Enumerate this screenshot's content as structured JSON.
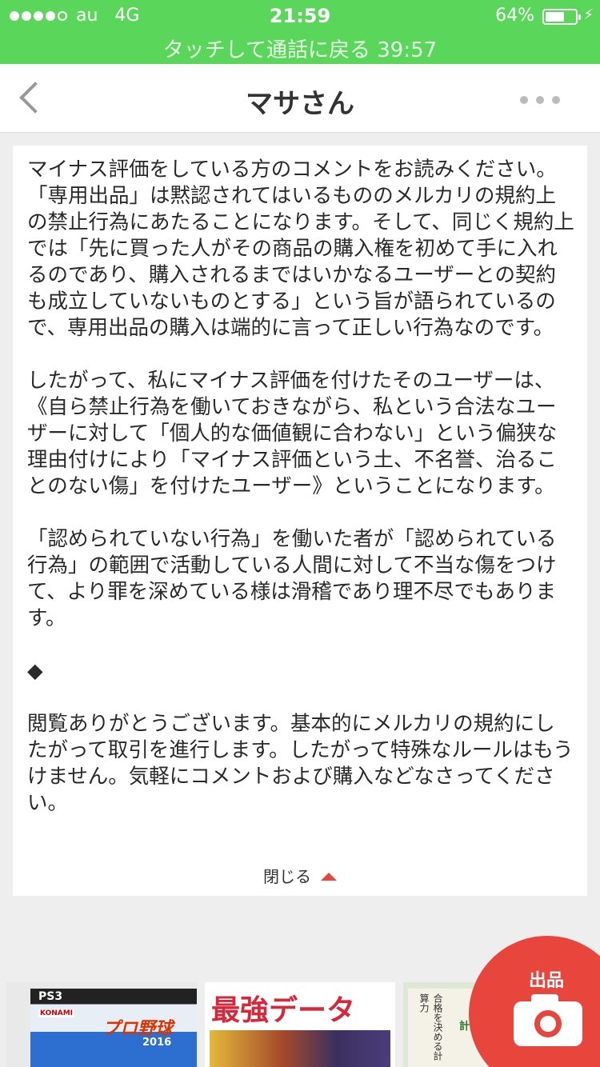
{
  "status_bar": {
    "carrier": "au",
    "network": "4G",
    "time": "21:59",
    "battery_percent": "64%",
    "battery_level": 0.64,
    "call_banner": "タッチして通話に戻る 39:57",
    "signal_icon": "signal-dots-icon",
    "charging_icon": "bolt-icon"
  },
  "nav": {
    "title": "マサさん",
    "back_icon": "chevron-left-icon",
    "more_icon": "more-dots-icon"
  },
  "description": "マイナス評価をしている方のコメントをお読みください。「専用出品」は黙認されてはいるもののメルカリの規約上の禁止行為にあたることになります。そして、同じく規約上では「先に買った人がその商品の購入権を初めて手に入れるのであり、購入されるまではいかなるユーザーとの契約も成立していないものとする」という旨が語られているので、専用出品の購入は端的に言って正しい行為なのです。\n\nしたがって、私にマイナス評価を付けたそのユーザーは、《自ら禁止行為を働いておきながら、私という合法なユーザーに対して「個人的な価値観に合わない」という偏狭な理由付けにより「マイナス評価という土、不名誉、治ることのない傷」を付けたユーザー》ということになります。\n\n「認められていない行為」を働いた者が「認められている行為」の範囲で活動している人間に対して不当な傷をつけて、より罪を深めている様は滑稽であり理不尽でもあります。\n\n◆\n\n閲覧ありがとうございます。基本的にメルカリの規約にしたがって取引を進行します。したがって特殊なルールはもうけません。気軽にコメントおよび購入などなさってください。",
  "close_label": "閉じる",
  "close_icon": "triangle-up-icon",
  "thumbnails": [
    {
      "ps3": "PS3",
      "publisher": "KONAMI",
      "title": "プロ野球",
      "year": "2016"
    },
    {
      "banner": "最強データ"
    },
    {
      "title": "合格を決める計算力",
      "subtitle": "計算力"
    }
  ],
  "fab": {
    "label": "出品",
    "icon": "camera-icon",
    "color": "#e8453c"
  },
  "colors": {
    "status_green": "#5ad65a",
    "accent_red": "#e8453c"
  }
}
